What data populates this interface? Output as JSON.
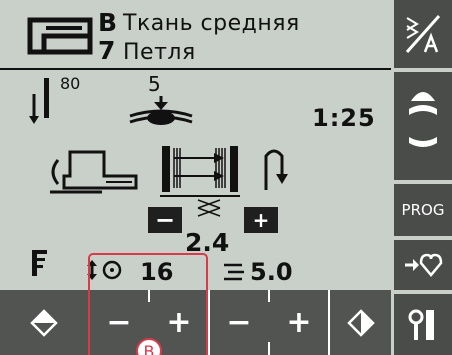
{
  "header": {
    "fabric_letter": "B",
    "fabric_name": "Ткань средняя",
    "stitch_number": "7",
    "stitch_name": "Петля"
  },
  "main": {
    "needle_value": "80",
    "presser_value": "5",
    "time": "1:25",
    "density_value": "2.4",
    "density_minus": "−",
    "density_plus": "+",
    "length_value": "16",
    "width_value": "5.0"
  },
  "bottom": {
    "b1_minus": "−",
    "b1_plus": "+",
    "b2_minus": "−",
    "b2_plus": "+"
  },
  "sidebar": {
    "prog_label": "PROG"
  },
  "annotation": {
    "label": "B"
  },
  "colors": {
    "lcd_bg": "#c9d0c9",
    "button_dark": "#4a4c4a",
    "highlight_red": "#d93a4a"
  }
}
